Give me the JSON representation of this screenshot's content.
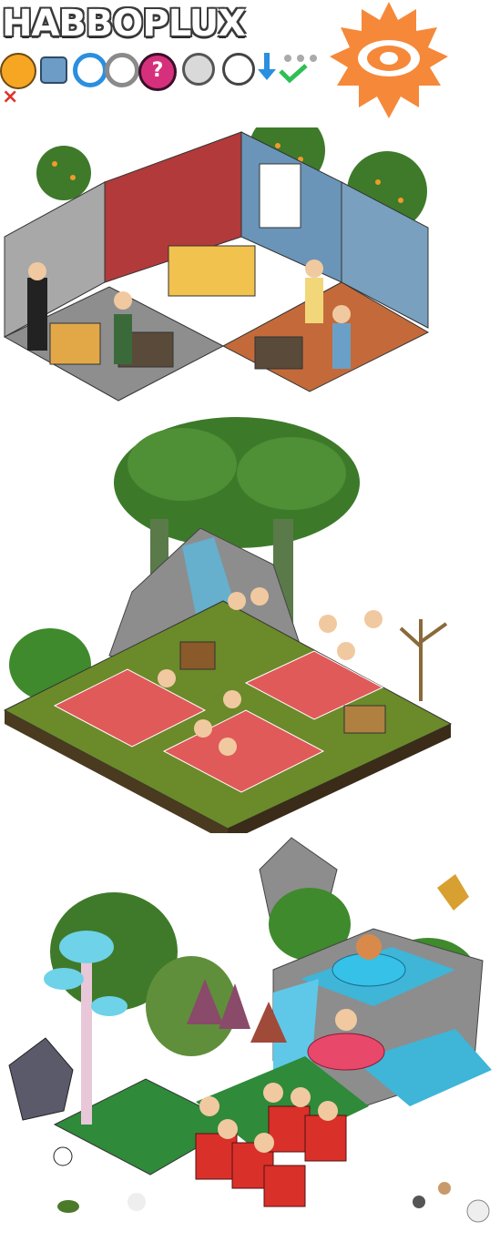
{
  "header": {
    "logo_text": "HABBOPLUX",
    "accent": "#f6883a"
  },
  "toolbar": {
    "icons": [
      "key-icon",
      "lock-icon",
      "blue-ring-icon",
      "grey-ring-icon",
      "help-icon",
      "compass-icon",
      "white-circle-icon",
      "download-arrow-icon",
      "checkmark-icon"
    ],
    "close_glyph": "×"
  },
  "colors": {
    "orange": "#f6883a",
    "grass": "#4f7a23",
    "picnic_red": "#e05a5a",
    "water": "#3fb5d8",
    "wall_red": "#b23a3a"
  }
}
